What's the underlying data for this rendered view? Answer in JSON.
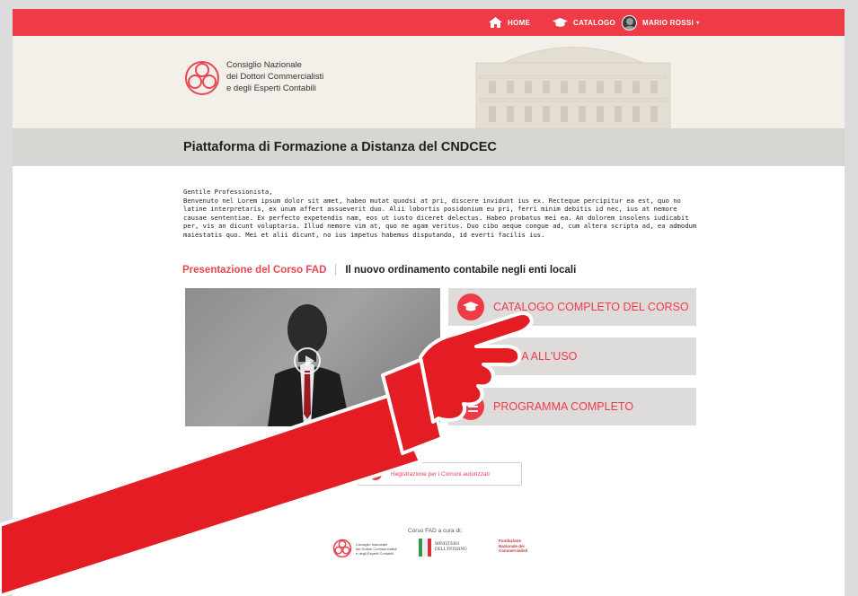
{
  "nav": {
    "home": "HOME",
    "catalog": "CATALOGO",
    "user": "MARIO ROSSI",
    "user_caret": "▾"
  },
  "header": {
    "org_line1": "Consiglio Nazionale",
    "org_line2": "dei Dottori Commercialisti",
    "org_line3": "e degli Esperti Contabili"
  },
  "page_title": "Piattaforma di Formazione a Distanza del CNDCEC",
  "intro": {
    "greeting": "Gentile Professionista,",
    "body": "Benvenuto nel Lorem ipsum dolor sit amet, habeo mutat quodsi at pri, discere invidunt ius ex. Recteque percipitur ea est, quo no latine interpretaris, ex unum affert assueverit duo. Alii lobortis posidonium eu pri, ferri minim debitis id nec, ius at nemore causae sententiae. Ex perfecto expetendis nam, eos ut iusto diceret delectus. Habeo probatus mei ea. An dolorem insolens iudicabit per, vis an dicunt voluptaria. Illud nemore vim at, quo ne agam veritus. Duo cibo aeque congue ad, cum altera scripta ad, ea admodum maiestatis quo. Mei et alii dicunt, no ius impetus habemus disputando, id everti facilis ius."
  },
  "course": {
    "presentation_label": "Presentazione del Corso FAD",
    "course_name": "Il nuovo ordinamento contabile negli enti locali"
  },
  "actions": {
    "catalog": "CATALOGO COMPLETO DEL CORSO",
    "guide": "GUIDA ALL'USO",
    "program": "PROGRAMMA COMPLETO"
  },
  "register_label": "Registrazione per i Comuni autorizzati",
  "footer": {
    "credits": "Corso FAD a cura di:",
    "partner1_line1": "Consiglio Nazionale",
    "partner1_line2": "dei Dottori Commercialisti",
    "partner1_line3": "e degli Esperti Contabili",
    "partner2_line1": "MINISTERO",
    "partner2_line2": "DELL'INTERNO",
    "partner3_line1": "Fondazione",
    "partner3_line2": "Nazionale dei",
    "partner3_line3": "Commercialisti"
  },
  "colors": {
    "brand_red": "#ef3b48",
    "header_bg": "#f3f0ea",
    "title_band": "#d8d6d3",
    "button_bg": "#dedcda"
  },
  "icons": [
    "home-icon",
    "graduation-cap-icon",
    "avatar",
    "play-icon",
    "list-icon",
    "pointing-hand-icon"
  ]
}
